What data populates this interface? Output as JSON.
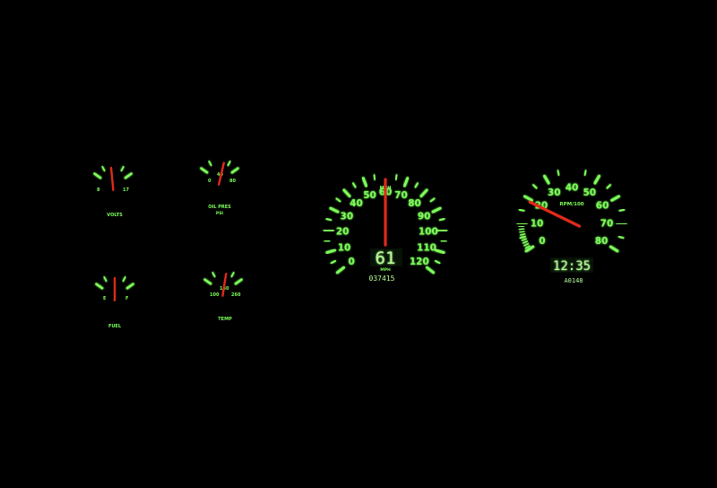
{
  "colors": {
    "glow": "#7dff5a",
    "needle": "#e02a1a",
    "background": "#000000"
  },
  "small_gauges": [
    {
      "id": "volts",
      "title": "VOLTS",
      "subtitle": "",
      "min_label": "8",
      "max_label": "17",
      "mid_label": "",
      "reading_fraction": 0.45
    },
    {
      "id": "oil",
      "title": "OIL PRES",
      "subtitle": "PSI",
      "min_label": "0",
      "max_label": "80",
      "mid_label": "40",
      "reading_fraction": 0.62
    },
    {
      "id": "fuel",
      "title": "FUEL",
      "subtitle": "",
      "min_label": "E",
      "max_label": "F",
      "mid_label": "",
      "reading_fraction": 0.5
    },
    {
      "id": "temp",
      "title": "TEMP",
      "subtitle": "",
      "min_label": "100",
      "max_label": "260",
      "mid_label": "180",
      "reading_fraction": 0.58
    }
  ],
  "speedometer": {
    "scale_labels": [
      "0",
      "10",
      "20",
      "30",
      "40",
      "50",
      "60",
      "70",
      "80",
      "90",
      "100",
      "110",
      "120"
    ],
    "unit_label": "MPH",
    "needle_value": 60,
    "digital_speed": "61",
    "digital_unit": "MPH",
    "odometer": "037415"
  },
  "tachometer": {
    "scale_labels": [
      "0",
      "10",
      "20",
      "30",
      "40",
      "50",
      "60",
      "70",
      "80"
    ],
    "unit_label": "RPM/100",
    "needle_value": 19,
    "clock": "12:35",
    "trip_readout": "A0148"
  }
}
